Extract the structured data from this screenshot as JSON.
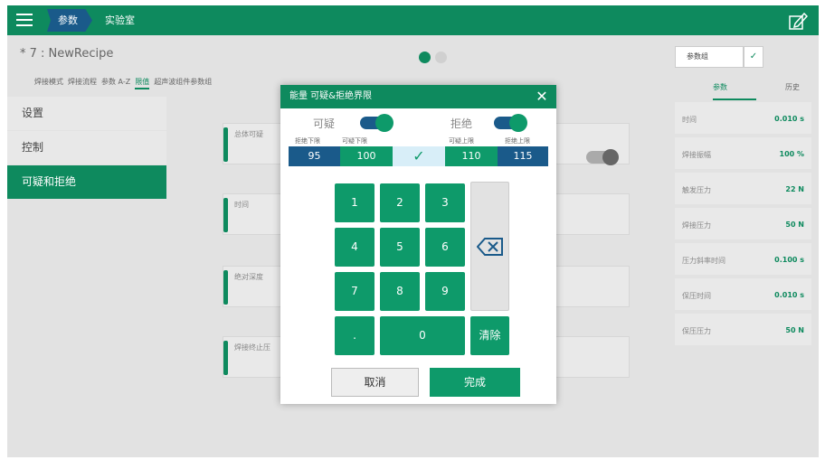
{
  "topbar": {
    "breadcrumb_params": "参数",
    "breadcrumb_lab": "实验室",
    "accent": "#0e8a5e"
  },
  "header": {
    "recipe_title": "* 7 : NewRecipe",
    "subnav": [
      "焊接模式",
      "焊接流程",
      "参数 A-Z",
      "限值",
      "超声波组件参数组"
    ],
    "subnav_active": "限值"
  },
  "left_menu": [
    "设置",
    "控制",
    "可疑和拒绝"
  ],
  "left_menu_active": "可疑和拒绝",
  "cards": [
    "总体可疑",
    "时间",
    "绝对深度",
    "焊接终止压"
  ],
  "right_panel": {
    "group_select": "参数组",
    "tabs": [
      "参数",
      "历史"
    ],
    "rows": [
      {
        "name": "时间",
        "value": "0.010 s"
      },
      {
        "name": "焊接振幅",
        "value": "100 %"
      },
      {
        "name": "触发压力",
        "value": "22 N"
      },
      {
        "name": "焊接压力",
        "value": "50 N"
      },
      {
        "name": "压力斜率时间",
        "value": "0.100 s"
      },
      {
        "name": "保压时间",
        "value": "0.010 s"
      },
      {
        "name": "保压压力",
        "value": "50 N"
      }
    ]
  },
  "dialog": {
    "title": "能量 可疑&拒绝界限",
    "suspect_label": "可疑",
    "reject_label": "拒绝",
    "threshold_labels": [
      "拒绝下限",
      "可疑下限",
      "可疑上限",
      "拒绝上限"
    ],
    "thresholds": [
      "95",
      "100",
      "110",
      "115"
    ],
    "keys": [
      "1",
      "2",
      "3",
      "4",
      "5",
      "6",
      "7",
      "8",
      "9",
      ".",
      "0"
    ],
    "clear_label": "清除",
    "cancel_label": "取消",
    "done_label": "完成"
  }
}
